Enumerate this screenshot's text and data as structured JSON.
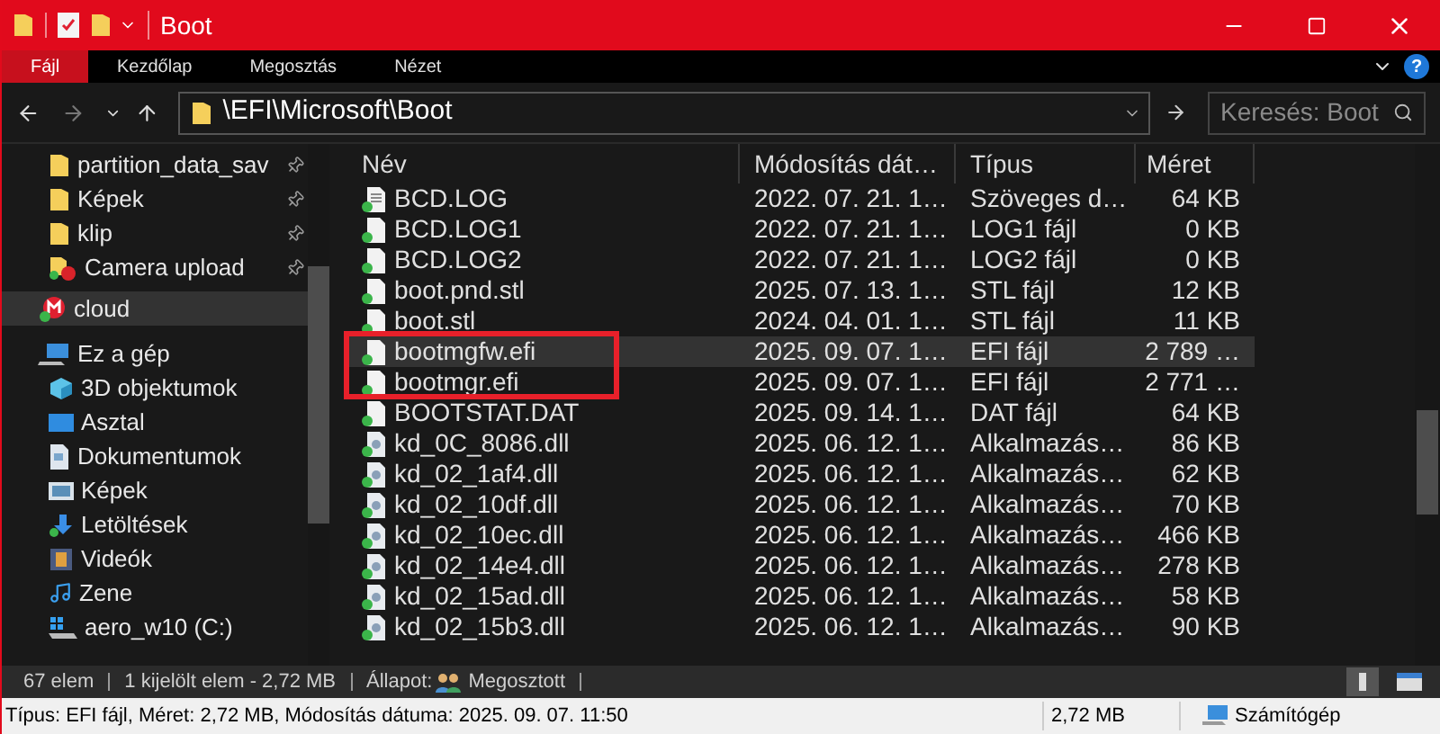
{
  "window": {
    "title": "Boot"
  },
  "ribbon": {
    "tabs": [
      {
        "label": "Fájl",
        "selected": true
      },
      {
        "label": "Kezdőlap",
        "selected": false
      },
      {
        "label": "Megosztás",
        "selected": false
      },
      {
        "label": "Nézet",
        "selected": false
      }
    ],
    "help": "?"
  },
  "address": {
    "path": "\\EFI\\Microsoft\\Boot"
  },
  "search": {
    "placeholder": "Keresés: Boot"
  },
  "nav": [
    {
      "label": "partition_data_sav",
      "kind": "folder",
      "pinned": true,
      "selected": false
    },
    {
      "label": "Képek",
      "kind": "folder",
      "pinned": true,
      "selected": false
    },
    {
      "label": "klip",
      "kind": "folder",
      "pinned": true,
      "selected": false
    },
    {
      "label": "Camera upload",
      "kind": "camera-folder",
      "pinned": true,
      "selected": false
    },
    {
      "label": "cloud",
      "kind": "cloud",
      "pinned": false,
      "selected": true
    },
    {
      "label": "Ez a gép",
      "kind": "pc",
      "pinned": false,
      "selected": false,
      "children": [
        {
          "label": "3D objektumok",
          "kind": "cube",
          "pinned": false,
          "selected": false
        },
        {
          "label": "Asztal",
          "kind": "desktop",
          "pinned": false,
          "selected": false
        },
        {
          "label": "Dokumentumok",
          "kind": "document",
          "pinned": false,
          "selected": false
        },
        {
          "label": "Képek",
          "kind": "pictures",
          "pinned": false,
          "selected": false
        },
        {
          "label": "Letöltések",
          "kind": "download",
          "pinned": false,
          "selected": false
        },
        {
          "label": "Videók",
          "kind": "video",
          "pinned": false,
          "selected": false
        },
        {
          "label": "Zene",
          "kind": "music",
          "pinned": false,
          "selected": false
        },
        {
          "label": "aero_w10 (C:)",
          "kind": "drive",
          "pinned": false,
          "selected": false
        }
      ]
    }
  ],
  "table": {
    "columns": [
      "Név",
      "Módosítás dát…",
      "Típus",
      "Méret"
    ],
    "rows": [
      {
        "name": "BCD.LOG",
        "date": "2022. 07. 21. 1…",
        "type": "Szöveges d…",
        "size": "64 KB",
        "kind": "text",
        "selected": false
      },
      {
        "name": "BCD.LOG1",
        "date": "2022. 07. 21. 1…",
        "type": "LOG1 fájl",
        "size": "0 KB",
        "kind": "file",
        "selected": false
      },
      {
        "name": "BCD.LOG2",
        "date": "2022. 07. 21. 1…",
        "type": "LOG2 fájl",
        "size": "0 KB",
        "kind": "file",
        "selected": false
      },
      {
        "name": "boot.pnd.stl",
        "date": "2025. 07. 13. 1…",
        "type": "STL fájl",
        "size": "12 KB",
        "kind": "file",
        "selected": false
      },
      {
        "name": "boot.stl",
        "date": "2024. 04. 01. 1…",
        "type": "STL fájl",
        "size": "11 KB",
        "kind": "file",
        "selected": false
      },
      {
        "name": "bootmgfw.efi",
        "date": "2025. 09. 07. 1…",
        "type": "EFI fájl",
        "size": "2 789 …",
        "kind": "file",
        "selected": true
      },
      {
        "name": "bootmgr.efi",
        "date": "2025. 09. 07. 1…",
        "type": "EFI fájl",
        "size": "2 771 …",
        "kind": "file",
        "selected": false
      },
      {
        "name": "BOOTSTAT.DAT",
        "date": "2025. 09. 14. 1…",
        "type": "DAT fájl",
        "size": "64 KB",
        "kind": "file",
        "selected": false
      },
      {
        "name": "kd_0C_8086.dll",
        "date": "2025. 06. 12. 1…",
        "type": "Alkalmazás…",
        "size": "86 KB",
        "kind": "dll",
        "selected": false
      },
      {
        "name": "kd_02_1af4.dll",
        "date": "2025. 06. 12. 1…",
        "type": "Alkalmazás…",
        "size": "62 KB",
        "kind": "dll",
        "selected": false
      },
      {
        "name": "kd_02_10df.dll",
        "date": "2025. 06. 12. 1…",
        "type": "Alkalmazás…",
        "size": "70 KB",
        "kind": "dll",
        "selected": false
      },
      {
        "name": "kd_02_10ec.dll",
        "date": "2025. 06. 12. 1…",
        "type": "Alkalmazás…",
        "size": "466 KB",
        "kind": "dll",
        "selected": false
      },
      {
        "name": "kd_02_14e4.dll",
        "date": "2025. 06. 12. 1…",
        "type": "Alkalmazás…",
        "size": "278 KB",
        "kind": "dll",
        "selected": false
      },
      {
        "name": "kd_02_15ad.dll",
        "date": "2025. 06. 12. 1…",
        "type": "Alkalmazás…",
        "size": "58 KB",
        "kind": "dll",
        "selected": false
      },
      {
        "name": "kd_02_15b3.dll",
        "date": "2025. 06. 12. 1…",
        "type": "Alkalmazás…",
        "size": "90 KB",
        "kind": "dll",
        "selected": false
      }
    ]
  },
  "status_bar": {
    "count": "67 elem",
    "selection": "1 kijelölt elem - 2,72 MB",
    "state_label": "Állapot:",
    "state": "Megosztott"
  },
  "details_bar": {
    "text": "Típus: EFI fájl, Méret: 2,72 MB, Módosítás dátuma: 2025. 09. 07. 11:50",
    "size": "2,72 MB",
    "location": "Számítógép"
  }
}
